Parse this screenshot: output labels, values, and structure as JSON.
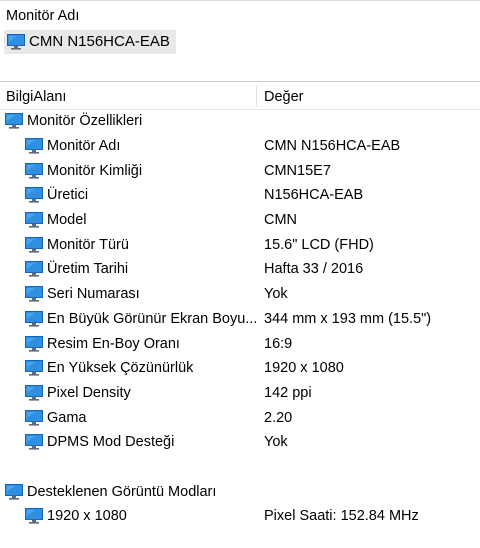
{
  "selector": {
    "label": "Monitör Adı",
    "value": "CMN N156HCA-EAB",
    "icon": "monitor-icon"
  },
  "table": {
    "columns": {
      "field": "BilgiAlanı",
      "value": "Değer"
    },
    "sections": [
      {
        "title": "Monitör Özellikleri",
        "icon": "monitor-icon",
        "rows": [
          {
            "field": "Monitör Adı",
            "value": "CMN N156HCA-EAB"
          },
          {
            "field": "Monitör Kimliği",
            "value": "CMN15E7"
          },
          {
            "field": "Üretici",
            "value": "N156HCA-EAB"
          },
          {
            "field": "Model",
            "value": "CMN"
          },
          {
            "field": "Monitör Türü",
            "value": "15.6\" LCD (FHD)"
          },
          {
            "field": "Üretim Tarihi",
            "value": "Hafta 33 / 2016"
          },
          {
            "field": "Seri Numarası",
            "value": "Yok"
          },
          {
            "field": "En Büyük Görünür Ekran Boyu...",
            "value": "344 mm x 193 mm (15.5\")"
          },
          {
            "field": "Resim En-Boy Oranı",
            "value": "16:9"
          },
          {
            "field": "En Yüksek Çözünürlük",
            "value": "1920 x 1080"
          },
          {
            "field": "Pixel Density",
            "value": "142 ppi"
          },
          {
            "field": "Gama",
            "value": "2.20"
          },
          {
            "field": "DPMS Mod Desteği",
            "value": "Yok"
          }
        ]
      },
      {
        "title": "Desteklenen Görüntü Modları",
        "icon": "monitor-icon",
        "rows": [
          {
            "field": "1920 x 1080",
            "value": "Pixel Saati: 152.84 MHz"
          }
        ]
      }
    ]
  },
  "colors": {
    "selection_bg": "#e8e8e8",
    "icon_screen": "#2f8fe0",
    "icon_screen_dark": "#1565c0",
    "icon_stand": "#5a6b7b"
  }
}
